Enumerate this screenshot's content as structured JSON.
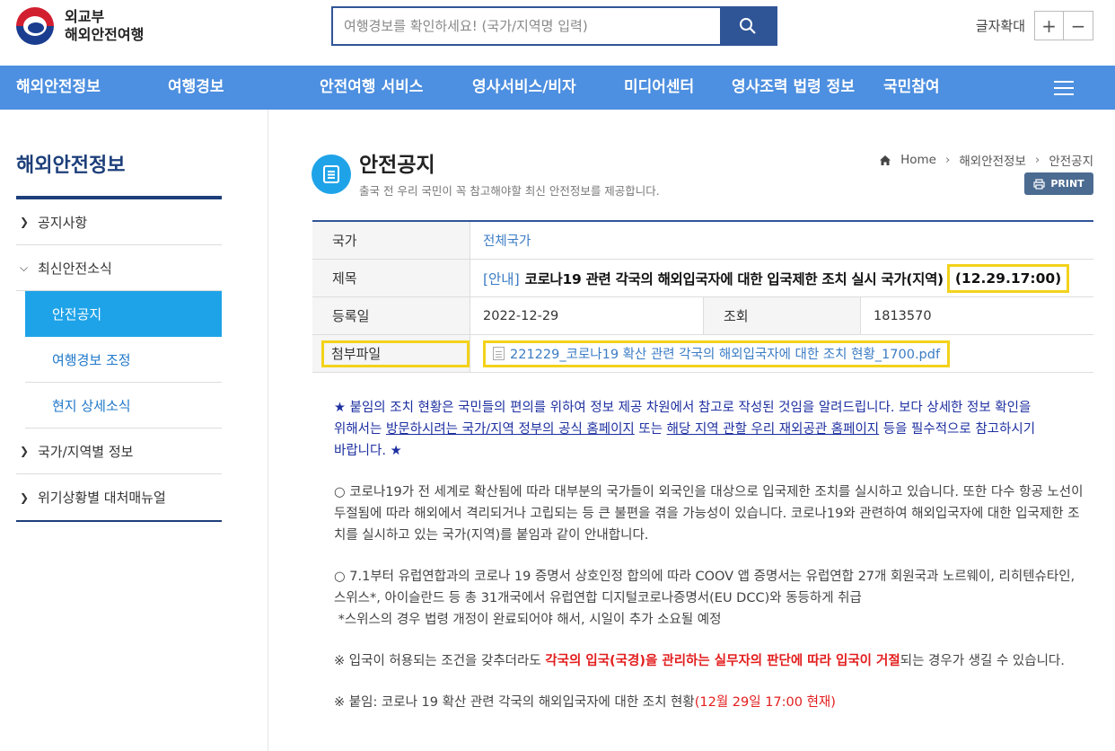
{
  "header": {
    "logo_line1": "외교부",
    "logo_line2": "해외안전여행",
    "search_placeholder": "여행경보를 확인하세요! (국가/지역명 입력)",
    "font_label": "글자확대",
    "font_plus": "+",
    "font_minus": "−"
  },
  "nav": {
    "items": [
      "해외안전정보",
      "여행경보",
      "안전여행 서비스",
      "영사서비스/비자",
      "미디어센터",
      "영사조력 법령 정보",
      "국민참여"
    ]
  },
  "sidebar": {
    "title": "해외안전정보",
    "items": [
      {
        "label": "공지사항",
        "chevron": "›"
      },
      {
        "label": "최신안전소식",
        "chevron": "⌄"
      }
    ],
    "subitems": [
      "안전공지",
      "여행경보 조정",
      "현지 상세소식"
    ],
    "items2": [
      {
        "label": "국가/지역별 정보",
        "chevron": "›"
      },
      {
        "label": "위기상황별 대처매뉴얼",
        "chevron": "›"
      }
    ]
  },
  "page": {
    "title": "안전공지",
    "desc": "출국 전 우리 국민이 꼭 참고해야할 최신 안전정보를 제공합니다.",
    "breadcrumb": [
      "Home",
      "해외안전정보",
      "안전공지"
    ],
    "print_label": "PRINT"
  },
  "table": {
    "country_label": "국가",
    "country_value": "전체국가",
    "subject_label": "제목",
    "subject_tag": "[안내]",
    "subject_title": "코로나19 관련 각국의 해외입국자에 대한 입국제한 조치 실시 국가(지역)",
    "subject_time": "(12.29.17:00)",
    "date_label": "등록일",
    "date_value": "2022-12-29",
    "views_label": "조회",
    "views_value": "1813570",
    "attach_label": "첨부파일",
    "attach_value": "221229_코로나19 확산 관련 각국의 해외입국자에 대한 조치 현황_1700.pdf"
  },
  "body": {
    "p1_a": "★ 붙임의 조치 현황은 국민들의 편의를 위하여 정보 제공 차원에서 참고로 작성된 것임을 알려드립니다. 보다 상세한 정보 확인을",
    "p1_b": "위해서는 ",
    "p1_link1": "방문하시려는 국가/지역 정부의 공식 홈페이지",
    "p1_c": " 또는 ",
    "p1_link2": "해당 지역 관할 우리 재외공관 홈페이지",
    "p1_d": " 등을 필수적으로 참고하시기",
    "p1_e": "바랍니다. ★",
    "p2": "○ 코로나19가 전 세계로 확산됨에 따라 대부분의 국가들이 외국인을 대상으로 입국제한 조치를 실시하고 있습니다. 또한 다수 항공 노선이 두절됨에 따라 해외에서 격리되거나 고립되는 등 큰 불편을 겪을 가능성이 있습니다. 코로나19와 관련하여 해외입국자에 대한 입국제한 조치를 실시하고 있는 국가(지역)를 붙임과 같이 안내합니다.",
    "p3_a": "○ 7.1부터 유럽연합과의 코로나 19 증명서 상호인정 합의에 따라 COOV 앱 증명서는 유럽연합 27개 회원국과 노르웨이, 리히텐슈타인, 스위스*, 아이슬란드 등 총 31개국에서 유럽연합 디지털코로나증명서(EU DCC)와 동등하게 취급",
    "p3_b": "*스위스의 경우 법령 개정이 완료되어야 해서, 시일이 추가 소요될 예정",
    "p4_a": "※ 입국이 허용되는 조건을 갖추더라도 ",
    "p4_red": "각국의 입국(국경)을 관리하는 실무자의 판단에 따라 입국이 거절",
    "p4_b": "되는 경우가 생길 수 있습니다.",
    "p5_a": "※ 붙임: 코로나 19 확산 관련 각국의 해외입국자에 대한 조치 현황",
    "p5_red": "(12월 29일 17:00 현재)"
  },
  "colors": {
    "nav_bg": "#4d8fe0",
    "accent": "#1fa3e8",
    "highlight": "#f3d21b",
    "navy": "#1d3f7a"
  }
}
